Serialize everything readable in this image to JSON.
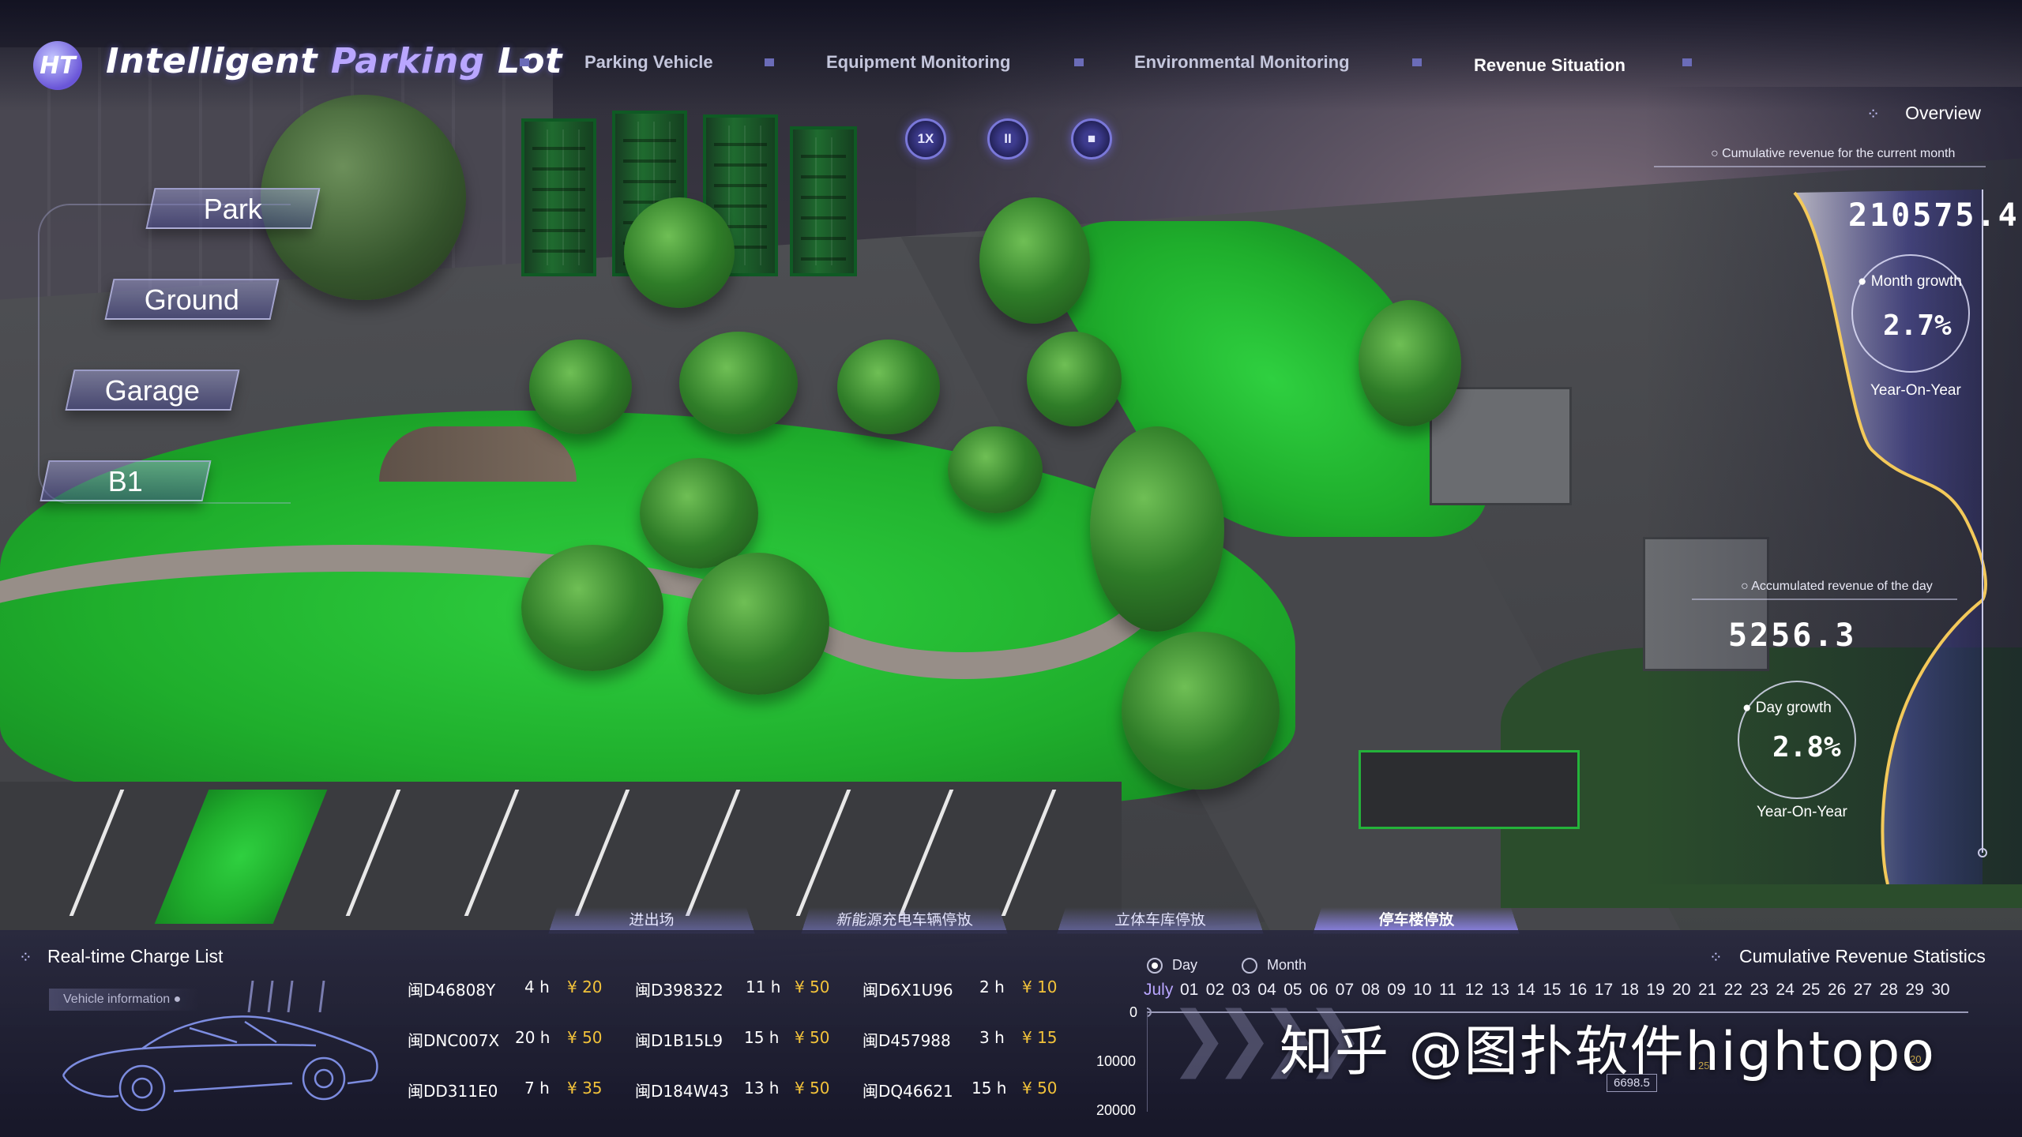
{
  "header": {
    "logo_text": "HT",
    "title_main": "Intelligent ",
    "title_accent": "Parking",
    "title_tail": " Lot",
    "nav": [
      {
        "label": "Parking Vehicle"
      },
      {
        "label": "Equipment Monitoring"
      },
      {
        "label": "Environmental Monitoring"
      },
      {
        "label": "Revenue Situation",
        "active": true
      }
    ]
  },
  "controls": {
    "speed_label": "1X",
    "pause_label": "II",
    "stop_label": "■"
  },
  "floors": [
    "Park",
    "Ground",
    "Garage",
    "B1"
  ],
  "overview": {
    "title": "Overview",
    "month_label": "Cumulative revenue for the current month",
    "month_value": "210575.4",
    "month_growth_label": "Month growth",
    "month_growth_value": "2.7%",
    "month_yoy": "Year-On-Year",
    "day_label": "Accumulated revenue of the day",
    "day_value": "5256.3",
    "day_growth_label": "Day growth",
    "day_growth_value": "2.8%",
    "day_yoy": "Year-On-Year",
    "curve_color": "#f3c95a"
  },
  "zones": [
    {
      "label": "进出场"
    },
    {
      "label": "新能源充电车辆停放"
    },
    {
      "label": "立体车库停放"
    },
    {
      "label": "停车楼停放",
      "active": true
    }
  ],
  "charge_list": {
    "title": "Real-time Charge List",
    "vehicle_info_label": "Vehicle information",
    "rows": [
      [
        {
          "plate": "闽D46808Y",
          "duration": "4 h",
          "price": "¥ 20"
        },
        {
          "plate": "闽D398322",
          "duration": "11 h",
          "price": "¥ 50"
        },
        {
          "plate": "闽D6X1U96",
          "duration": "2 h",
          "price": "¥ 10"
        }
      ],
      [
        {
          "plate": "闽DNC007X",
          "duration": "20 h",
          "price": "¥ 50"
        },
        {
          "plate": "闽D1B15L9",
          "duration": "15 h",
          "price": "¥ 50"
        },
        {
          "plate": "闽D457988",
          "duration": "3 h",
          "price": "¥ 15"
        }
      ],
      [
        {
          "plate": "闽DD311E0",
          "duration": "7 h",
          "price": "¥ 35"
        },
        {
          "plate": "闽D184W43",
          "duration": "13 h",
          "price": "¥ 50"
        },
        {
          "plate": "闽DQ46621",
          "duration": "15 h",
          "price": "¥ 50"
        }
      ]
    ]
  },
  "revenue_stats": {
    "title": "Cumulative Revenue Statistics",
    "mode_day": "Day",
    "mode_month": "Month",
    "selected_mode": "Day",
    "month_label": "July",
    "days": [
      "01",
      "02",
      "03",
      "04",
      "05",
      "06",
      "07",
      "08",
      "09",
      "10",
      "11",
      "12",
      "13",
      "14",
      "15",
      "16",
      "17",
      "18",
      "19",
      "20",
      "21",
      "22",
      "23",
      "24",
      "25",
      "26",
      "27",
      "28",
      "29",
      "30"
    ],
    "y_ticks": [
      "0",
      "10000",
      "20000"
    ],
    "tooltip_value": "6698.5",
    "tooltip_partial_1": "252",
    "tooltip_partial_2": "20"
  },
  "watermark": "知乎 @图扑软件hightopo"
}
